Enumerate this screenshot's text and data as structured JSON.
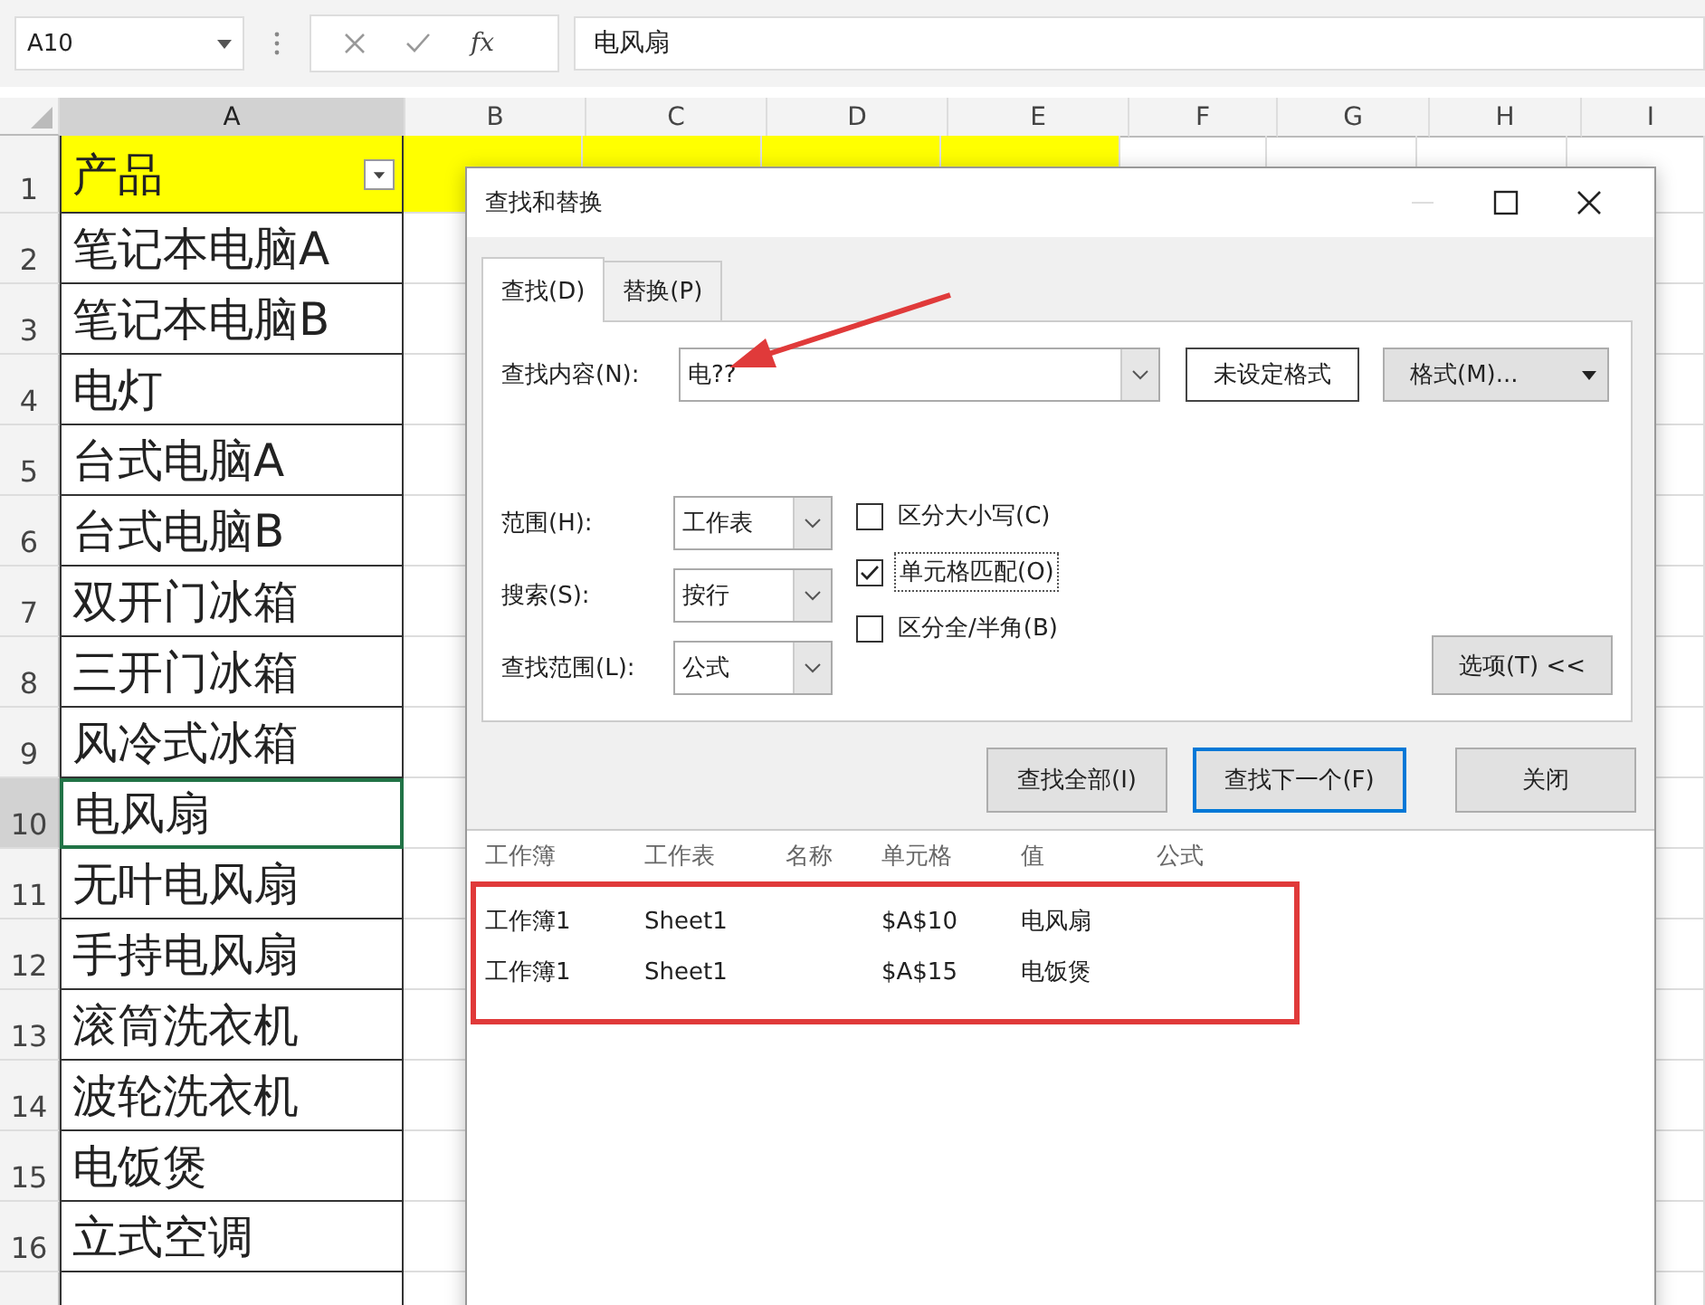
{
  "name_box": {
    "value": "A10"
  },
  "formula_bar": {
    "fx": "fx",
    "value": "电风扇"
  },
  "columns": [
    {
      "label": "A",
      "selected": true
    },
    {
      "label": "B",
      "selected": false
    },
    {
      "label": "C",
      "selected": false
    },
    {
      "label": "D",
      "selected": false
    },
    {
      "label": "E",
      "selected": false
    },
    {
      "label": "F",
      "selected": false
    },
    {
      "label": "G",
      "selected": false
    },
    {
      "label": "H",
      "selected": false
    },
    {
      "label": "I",
      "selected": false
    }
  ],
  "rows": [
    {
      "number": "1",
      "kind": "header",
      "text": "产品",
      "selected": false
    },
    {
      "number": "2",
      "kind": "data",
      "text": "笔记本电脑A",
      "selected": false
    },
    {
      "number": "3",
      "kind": "data",
      "text": "笔记本电脑B",
      "selected": false
    },
    {
      "number": "4",
      "kind": "data",
      "text": "电灯",
      "selected": false
    },
    {
      "number": "5",
      "kind": "data",
      "text": "台式电脑A",
      "selected": false
    },
    {
      "number": "6",
      "kind": "data",
      "text": "台式电脑B",
      "selected": false
    },
    {
      "number": "7",
      "kind": "data",
      "text": "双开门冰箱",
      "selected": false
    },
    {
      "number": "8",
      "kind": "data",
      "text": "三开门冰箱",
      "selected": false
    },
    {
      "number": "9",
      "kind": "data",
      "text": "风冷式冰箱",
      "selected": false
    },
    {
      "number": "10",
      "kind": "data",
      "text": "电风扇",
      "selected": true
    },
    {
      "number": "11",
      "kind": "data",
      "text": "无叶电风扇",
      "selected": false
    },
    {
      "number": "12",
      "kind": "data",
      "text": "手持电风扇",
      "selected": false
    },
    {
      "number": "13",
      "kind": "data",
      "text": "滚筒洗衣机",
      "selected": false
    },
    {
      "number": "14",
      "kind": "data",
      "text": "波轮洗衣机",
      "selected": false
    },
    {
      "number": "15",
      "kind": "data",
      "text": "电饭煲",
      "selected": false
    },
    {
      "number": "16",
      "kind": "data",
      "text": "立式空调",
      "selected": false
    }
  ],
  "dialog": {
    "title": "查找和替换",
    "tabs": [
      {
        "label": "查找(D)",
        "selected": true
      },
      {
        "label": "替换(P)",
        "selected": false
      }
    ],
    "find": {
      "label": "查找内容(N):",
      "value": "电??",
      "no_format": "未设定格式",
      "format": "格式(M)..."
    },
    "selects": [
      {
        "label": "范围(H):",
        "value": "工作表"
      },
      {
        "label": "搜索(S):",
        "value": "按行"
      },
      {
        "label": "查找范围(L):",
        "value": "公式"
      }
    ],
    "checkboxes": [
      {
        "label": "区分大小写(C)",
        "checked": false
      },
      {
        "label": "单元格匹配(O)",
        "checked": true
      },
      {
        "label": "区分全/半角(B)",
        "checked": false
      }
    ],
    "options_button": "选项(T) <<",
    "buttons": [
      {
        "label": "查找全部(I)",
        "focused": false
      },
      {
        "label": "查找下一个(F)",
        "focused": true
      },
      {
        "label": "关闭",
        "focused": false
      }
    ],
    "results": {
      "columns": [
        "工作簿",
        "工作表",
        "名称",
        "单元格",
        "值",
        "公式"
      ],
      "rows": [
        {
          "workbook": "工作簿1",
          "sheet": "Sheet1",
          "cell": "$A$10",
          "value": "电风扇"
        },
        {
          "workbook": "工作簿1",
          "sheet": "Sheet1",
          "cell": "$A$15",
          "value": "电饭煲"
        }
      ]
    }
  }
}
